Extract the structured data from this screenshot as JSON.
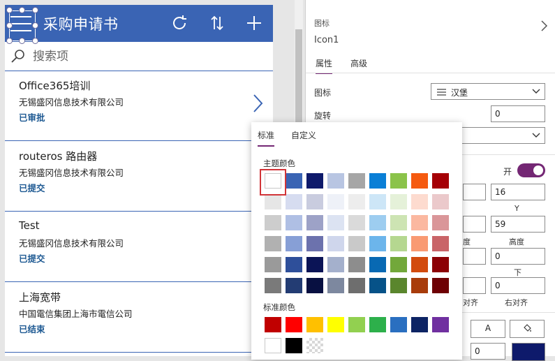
{
  "app": {
    "title": "采购申请书",
    "search_placeholder": "搜索项",
    "header_color": "#3a64b4",
    "items": [
      {
        "title": "Office365培训",
        "company": "无锡盛冈信息技术有限公司",
        "status": "已审批"
      },
      {
        "title": "routeros 路由器",
        "company": "无锡盛冈信息技术有限公司",
        "status": "已提交"
      },
      {
        "title": "Test",
        "company": "无锡盛冈信息技术有限公司",
        "status": "已提交"
      },
      {
        "title": "上海宽带",
        "company": "中国電信集团上海市電信公司",
        "status": "已结束"
      }
    ]
  },
  "pane": {
    "control_type": "图标",
    "control_name": "Icon1",
    "tab_properties": "属性",
    "tab_advanced": "高级",
    "icon_label": "图标",
    "icon_value": "汉堡",
    "rotation_label": "旋转",
    "rotation_value": "0",
    "toggle_label": "开",
    "x_value": "16",
    "y_label": "Y",
    "width_value": "59",
    "width_label_partial": "度",
    "height_label": "高度",
    "padding_top_value": "0",
    "padding_bottom_label": "下",
    "padding_left_value": "",
    "padding_right_value": "0",
    "align_label_partial": "对齐",
    "right_align_label": "右对齐",
    "font_button": "A",
    "border_value": "0"
  },
  "picker": {
    "tab_standard": "标准",
    "tab_custom": "自定义",
    "theme_label": "主题颜色",
    "standard_label": "标准颜色",
    "theme_rows": [
      [
        "#ffffff",
        "#3a64b4",
        "#0e1a6b",
        "#b8c5e2",
        "#a6a6a6",
        "#0a7fd6",
        "#8bc34a",
        "#f55a10",
        "#a50006"
      ],
      [
        "#e6e6e6",
        "#d6dcf0",
        "#c9ccdf",
        "#eef1f8",
        "#ededed",
        "#cde6f7",
        "#e5f1d9",
        "#fddbcf",
        "#ebc9cb"
      ],
      [
        "#cdcdcd",
        "#afbfe4",
        "#9da2c7",
        "#dce3f2",
        "#dadada",
        "#9dcdf0",
        "#cde4b3",
        "#fbb8a0",
        "#da9699"
      ],
      [
        "#b1b1b1",
        "#879fd6",
        "#6c72ad",
        "#cfd6ec",
        "#c9c9c9",
        "#6cb5eb",
        "#b5d790",
        "#f99a72",
        "#c96468"
      ],
      [
        "#9a9a9a",
        "#2e4f9a",
        "#0b1456",
        "#a4b0cc",
        "#8d8d8d",
        "#0869b3",
        "#72a83a",
        "#d24b0e",
        "#8c0005"
      ],
      [
        "#7a7a7a",
        "#233c73",
        "#081041",
        "#7d889f",
        "#6e6e6e",
        "#065288",
        "#5a862d",
        "#a83c0b",
        "#6e0004"
      ]
    ],
    "standard_rows": [
      [
        "#c00000",
        "#ff0000",
        "#ffc000",
        "#ffff00",
        "#92d050",
        "#2db04b",
        "#2a6fc0",
        "#0d2464",
        "#7030a0"
      ],
      [
        "#ffffff",
        "#000000",
        "transparent"
      ]
    ]
  }
}
